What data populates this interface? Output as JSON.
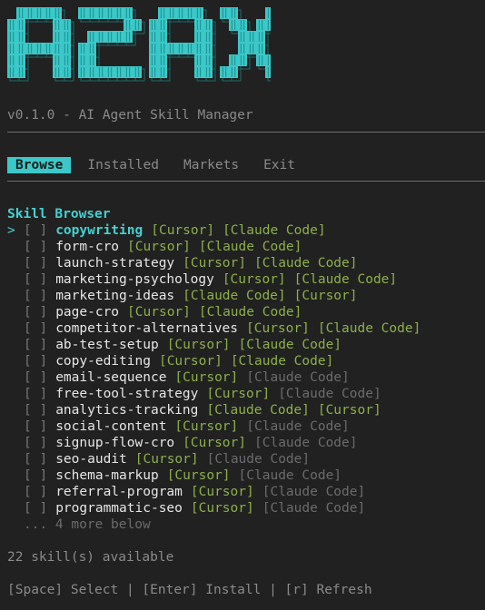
{
  "logo": {
    "text": "A2AX"
  },
  "version_line": "v0.1.0 - AI Agent Skill Manager",
  "tabs": [
    {
      "label": "Browse",
      "active": true
    },
    {
      "label": "Installed",
      "active": false
    },
    {
      "label": "Markets",
      "active": false
    },
    {
      "label": "Exit",
      "active": false
    }
  ],
  "browser": {
    "title": "Skill Browser",
    "cursor_glyph": ">",
    "checkbox_glyph": "[ ]",
    "skills": [
      {
        "name": "copywriting",
        "selected": true,
        "tags": [
          {
            "label": "[Cursor]",
            "state": "available"
          },
          {
            "label": "[Claude Code]",
            "state": "available"
          }
        ]
      },
      {
        "name": "form-cro",
        "selected": false,
        "tags": [
          {
            "label": "[Cursor]",
            "state": "available"
          },
          {
            "label": "[Claude Code]",
            "state": "available"
          }
        ]
      },
      {
        "name": "launch-strategy",
        "selected": false,
        "tags": [
          {
            "label": "[Cursor]",
            "state": "available"
          },
          {
            "label": "[Claude Code]",
            "state": "available"
          }
        ]
      },
      {
        "name": "marketing-psychology",
        "selected": false,
        "tags": [
          {
            "label": "[Cursor]",
            "state": "available"
          },
          {
            "label": "[Claude Code]",
            "state": "available"
          }
        ]
      },
      {
        "name": "marketing-ideas",
        "selected": false,
        "tags": [
          {
            "label": "[Claude Code]",
            "state": "available"
          },
          {
            "label": "[Cursor]",
            "state": "available"
          }
        ]
      },
      {
        "name": "page-cro",
        "selected": false,
        "tags": [
          {
            "label": "[Cursor]",
            "state": "available"
          },
          {
            "label": "[Claude Code]",
            "state": "available"
          }
        ]
      },
      {
        "name": "competitor-alternatives",
        "selected": false,
        "tags": [
          {
            "label": "[Cursor]",
            "state": "available"
          },
          {
            "label": "[Claude Code]",
            "state": "available"
          }
        ]
      },
      {
        "name": "ab-test-setup",
        "selected": false,
        "tags": [
          {
            "label": "[Cursor]",
            "state": "available"
          },
          {
            "label": "[Claude Code]",
            "state": "available"
          }
        ]
      },
      {
        "name": "copy-editing",
        "selected": false,
        "tags": [
          {
            "label": "[Cursor]",
            "state": "available"
          },
          {
            "label": "[Claude Code]",
            "state": "available"
          }
        ]
      },
      {
        "name": "email-sequence",
        "selected": false,
        "tags": [
          {
            "label": "[Cursor]",
            "state": "available"
          },
          {
            "label": "[Claude Code]",
            "state": "dim"
          }
        ]
      },
      {
        "name": "free-tool-strategy",
        "selected": false,
        "tags": [
          {
            "label": "[Cursor]",
            "state": "available"
          },
          {
            "label": "[Claude Code]",
            "state": "dim"
          }
        ]
      },
      {
        "name": "analytics-tracking",
        "selected": false,
        "tags": [
          {
            "label": "[Claude Code]",
            "state": "available"
          },
          {
            "label": "[Cursor]",
            "state": "available"
          }
        ]
      },
      {
        "name": "social-content",
        "selected": false,
        "tags": [
          {
            "label": "[Cursor]",
            "state": "available"
          },
          {
            "label": "[Claude Code]",
            "state": "dim"
          }
        ]
      },
      {
        "name": "signup-flow-cro",
        "selected": false,
        "tags": [
          {
            "label": "[Cursor]",
            "state": "available"
          },
          {
            "label": "[Claude Code]",
            "state": "dim"
          }
        ]
      },
      {
        "name": "seo-audit",
        "selected": false,
        "tags": [
          {
            "label": "[Cursor]",
            "state": "available"
          },
          {
            "label": "[Claude Code]",
            "state": "dim"
          }
        ]
      },
      {
        "name": "schema-markup",
        "selected": false,
        "tags": [
          {
            "label": "[Cursor]",
            "state": "available"
          },
          {
            "label": "[Claude Code]",
            "state": "dim"
          }
        ]
      },
      {
        "name": "referral-program",
        "selected": false,
        "tags": [
          {
            "label": "[Cursor]",
            "state": "available"
          },
          {
            "label": "[Claude Code]",
            "state": "dim"
          }
        ]
      },
      {
        "name": "programmatic-seo",
        "selected": false,
        "tags": [
          {
            "label": "[Cursor]",
            "state": "available"
          },
          {
            "label": "[Claude Code]",
            "state": "dim"
          }
        ]
      }
    ],
    "more_text": "... 4 more below"
  },
  "count_text": "22 skill(s) available",
  "help_text": "[Space] Select | [Enter] Install | [r] Refresh",
  "colors": {
    "background": "#212121",
    "accent": "#3cc8c8",
    "tag_available": "#8cb04a",
    "tag_dim": "#6b6b6b"
  }
}
